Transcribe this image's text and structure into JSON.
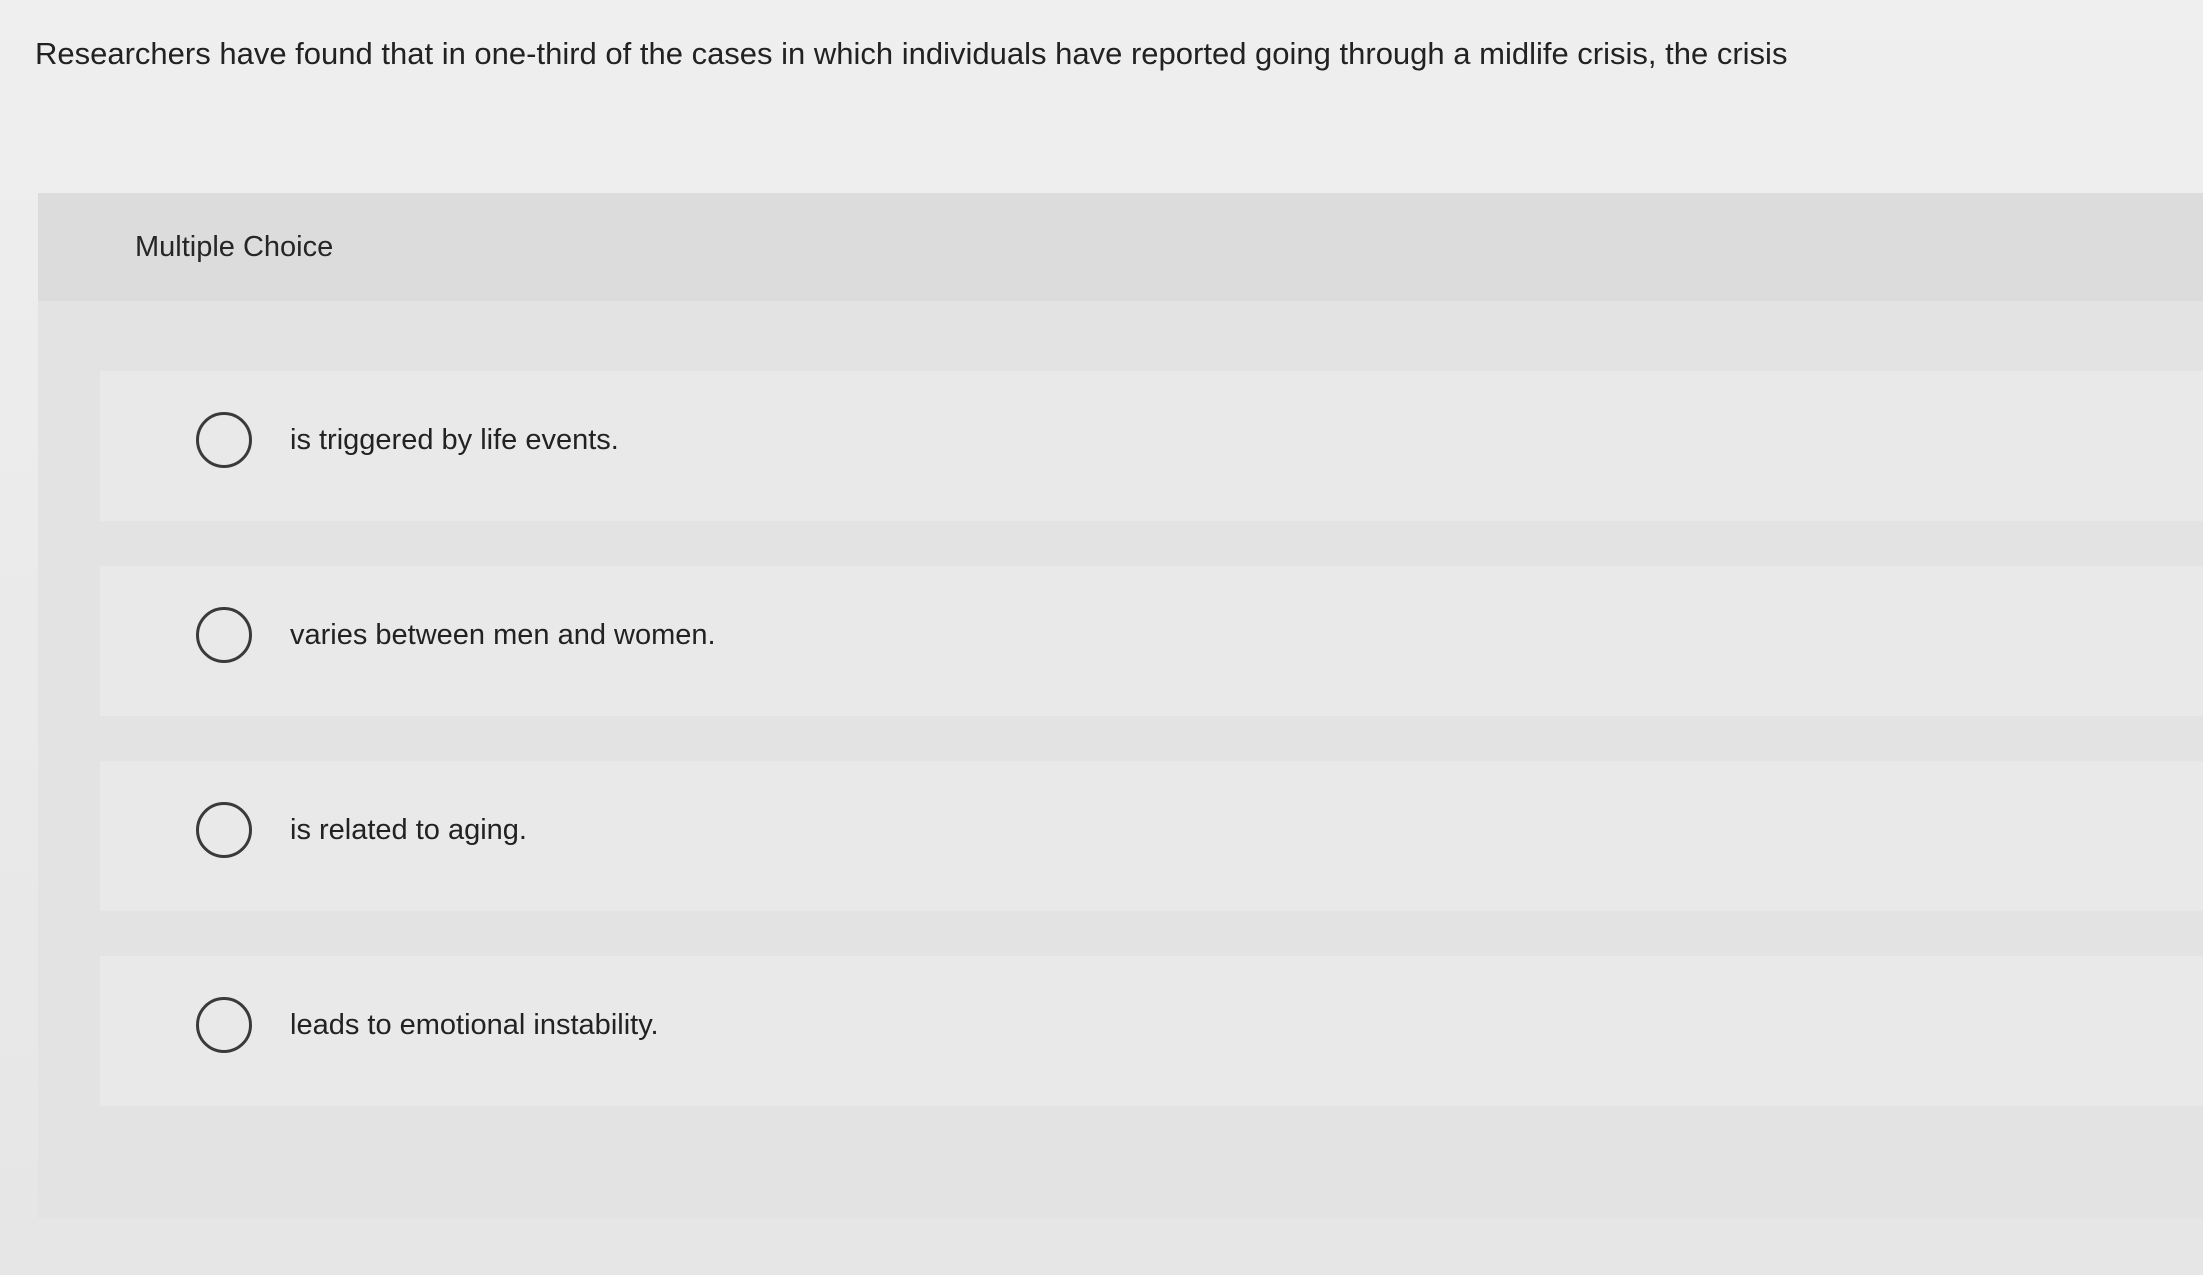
{
  "question": {
    "text": "Researchers have found that in one-third of the cases in which individuals have reported going through a midlife crisis, the crisis"
  },
  "multiple_choice": {
    "label": "Multiple Choice",
    "options": [
      {
        "label": "is triggered by life events.",
        "icon": "radio-unselected-icon"
      },
      {
        "label": "varies between men and women.",
        "icon": "radio-unselected-icon"
      },
      {
        "label": "is related to aging.",
        "icon": "radio-unselected-icon"
      },
      {
        "label": "leads to emotional instability.",
        "icon": "radio-unselected-icon"
      }
    ]
  },
  "colors": {
    "background": "#ebebeb",
    "panel": "#e3e3e3",
    "header": "#dcdcdc",
    "option_row": "#e9e9e9",
    "text": "#222222",
    "radio_border": "#3a3a3a"
  }
}
